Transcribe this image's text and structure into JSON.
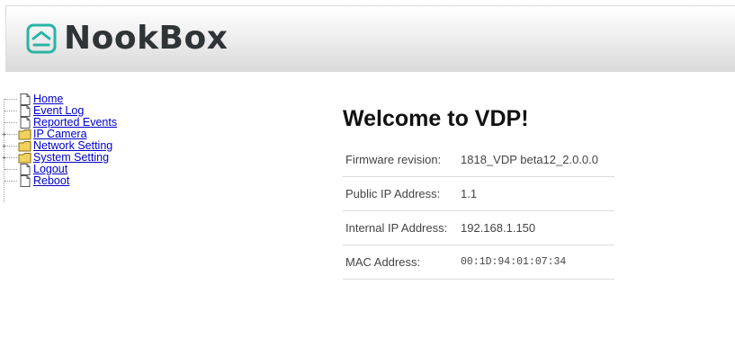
{
  "header": {
    "brand": "NookBox"
  },
  "sidebar": {
    "items": [
      {
        "label": "Home",
        "icon": "page-icon",
        "expandable": false
      },
      {
        "label": "Event Log",
        "icon": "page-icon",
        "expandable": false
      },
      {
        "label": "Reported Events",
        "icon": "page-icon",
        "expandable": false
      },
      {
        "label": "IP Camera",
        "icon": "folder-icon",
        "expandable": true
      },
      {
        "label": "Network Setting",
        "icon": "folder-icon",
        "expandable": true
      },
      {
        "label": "System Setting",
        "icon": "folder-icon",
        "expandable": true
      },
      {
        "label": "Logout",
        "icon": "page-icon",
        "expandable": false
      },
      {
        "label": "Reboot",
        "icon": "page-icon",
        "expandable": false
      }
    ]
  },
  "main": {
    "title": "Welcome to VDP!",
    "info": [
      {
        "label": "Firmware revision:",
        "value": "1818_VDP beta12_2.0.0.0"
      },
      {
        "label": "Public IP Address:",
        "value": "1.1"
      },
      {
        "label": "Internal IP Address:",
        "value": "192.168.1.150"
      },
      {
        "label": "MAC Address:",
        "value": "00:1D:94:01:07:34"
      }
    ]
  },
  "colors": {
    "brand_accent": "#2ab3a6",
    "link": "#0000cc",
    "folder": "#f2d15c"
  }
}
